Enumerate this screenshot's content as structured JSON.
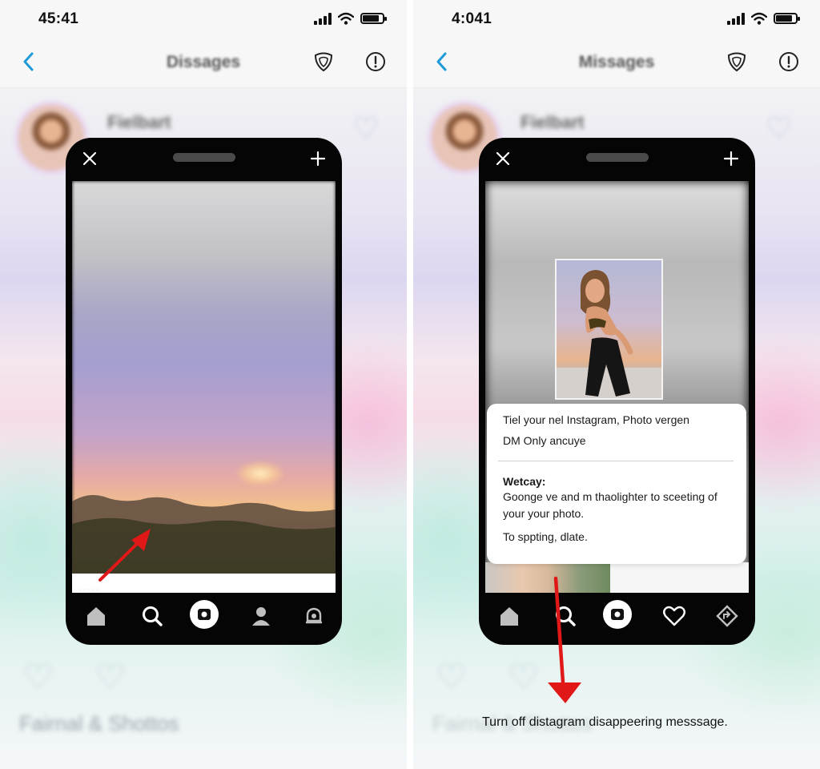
{
  "left_panel": {
    "status": {
      "time": "45:41"
    },
    "nav": {
      "title": "Dissages"
    },
    "blurred_contact": {
      "name": "Fielbart"
    },
    "blurred_footer": {
      "text": "Fairnal & Shottos"
    }
  },
  "right_panel": {
    "status": {
      "time": "4:041"
    },
    "nav": {
      "title": "Missages"
    },
    "blurred_contact": {
      "name": "Fielbart"
    },
    "blurred_footer": {
      "text": "Fairnal & Shottos"
    },
    "info_card": {
      "line1": "Tiel your nel Instagram, Photo vergen",
      "line2": "DM Only ancuye",
      "heading": "Wetcay:",
      "line3": "Goonge ve and m thaolighter to sceeting of",
      "line4": "your your photo.",
      "line5": "To sppting, dlate."
    },
    "caption": "Turn off distagram disappeering messsage."
  },
  "colors": {
    "accent_blue": "#1e9bd7",
    "arrow_red": "#e01818",
    "phone_frame": "#050505"
  },
  "icons": {
    "nav": [
      "back-chevron-icon",
      "shield-icon",
      "info-icon"
    ],
    "phone_top": [
      "close-icon",
      "plus-icon"
    ],
    "tabbar_left": [
      "home-icon",
      "search-icon",
      "camera-icon",
      "profile-icon",
      "notification-icon"
    ],
    "tabbar_right": [
      "home-icon",
      "search-icon",
      "camera-icon",
      "heart-icon",
      "directions-icon"
    ]
  }
}
